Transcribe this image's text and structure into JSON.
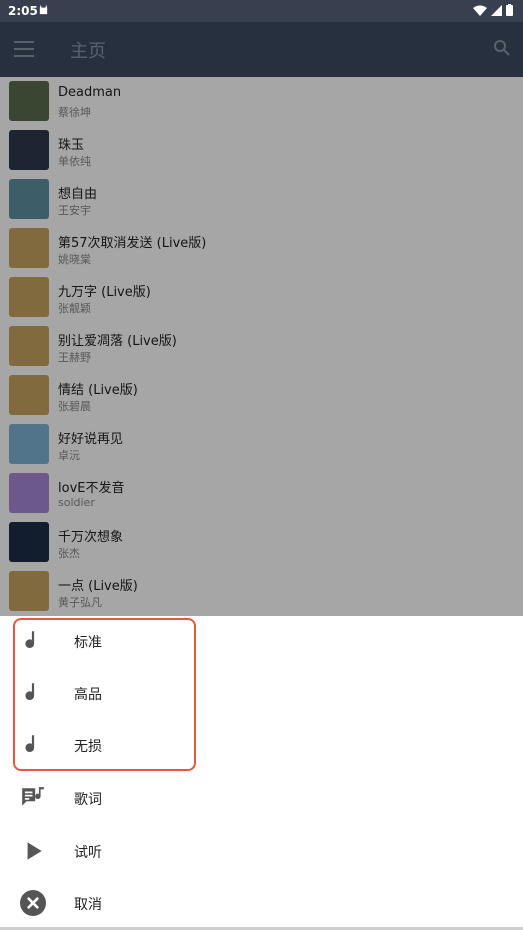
{
  "status_bar": {
    "time": "2:05"
  },
  "app_bar": {
    "title": "主页"
  },
  "songs": [
    {
      "title": "Deadman",
      "artist": "蔡徐坤",
      "cover": "#5a6b4e"
    },
    {
      "title": "珠玉",
      "artist": "单依纯",
      "cover": "#2c3a4c"
    },
    {
      "title": "想自由",
      "artist": "王安宇",
      "cover": "#5f8fa0"
    },
    {
      "title": "第57次取消发送 (Live版)",
      "artist": "姚晓棠",
      "cover": "#c6a560"
    },
    {
      "title": "九万字 (Live版)",
      "artist": "张靓颖",
      "cover": "#c6a560"
    },
    {
      "title": "别让爱凋落 (Live版)",
      "artist": "王赫野",
      "cover": "#c6a560"
    },
    {
      "title": "情结 (Live版)",
      "artist": "张碧晨",
      "cover": "#c6a560"
    },
    {
      "title": "好好说再见",
      "artist": "卓沅",
      "cover": "#7fb3d6"
    },
    {
      "title": "lovE不发音",
      "artist": "soldier",
      "cover": "#a888d6"
    },
    {
      "title": "千万次想象",
      "artist": "张杰",
      "cover": "#1d2d48"
    },
    {
      "title": "一点 (Live版)",
      "artist": "黄子弘凡",
      "cover": "#c6a560"
    }
  ],
  "sheet": {
    "items": [
      {
        "label": "标准",
        "icon": "music-note-icon"
      },
      {
        "label": "高品",
        "icon": "music-note-icon"
      },
      {
        "label": "无损",
        "icon": "music-note-icon"
      },
      {
        "label": "歌词",
        "icon": "lyrics-icon"
      },
      {
        "label": "试听",
        "icon": "play-icon"
      },
      {
        "label": "取消",
        "icon": "cancel-icon"
      }
    ]
  },
  "colors": {
    "app_bar": "#3b4a60",
    "status_bar": "#38404f",
    "highlight": "#e05a43",
    "icon": "#555555"
  }
}
